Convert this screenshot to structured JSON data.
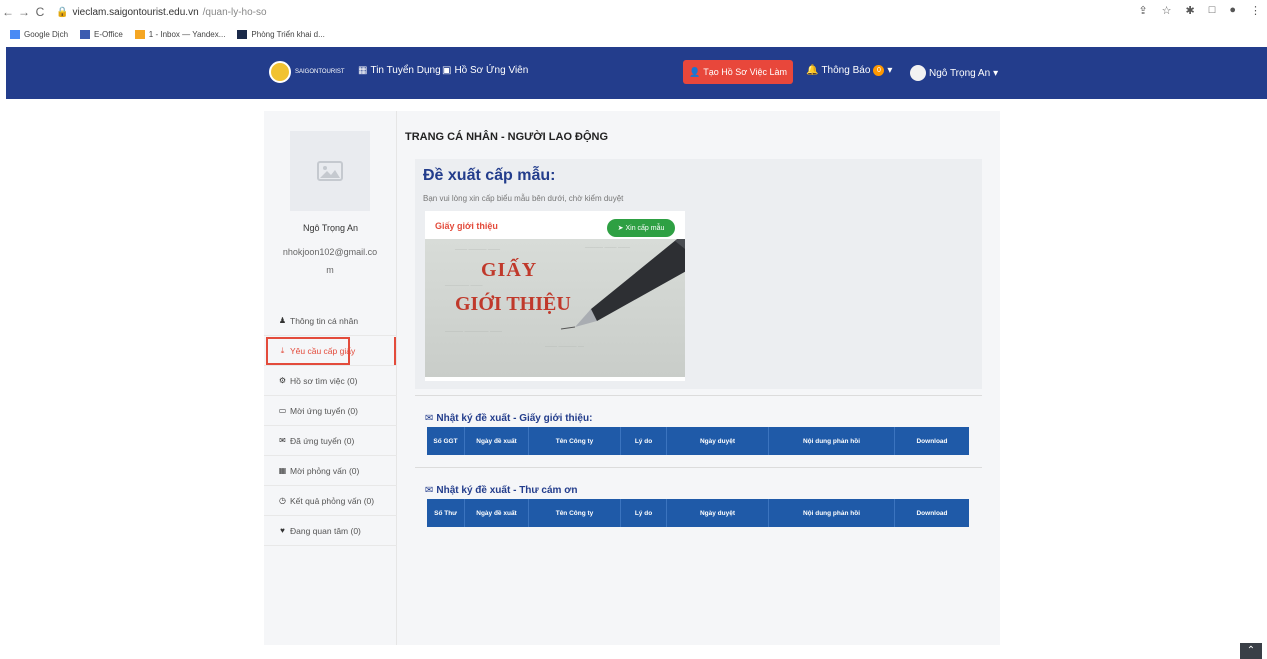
{
  "browser": {
    "url_host": "vieclam.saigontourist.edu.vn",
    "url_path": "/quan-ly-ho-so",
    "bookmarks": [
      "Google Dịch",
      "E-Office",
      "1 - Inbox — Yandex...",
      "Phòng Triển khai d..."
    ]
  },
  "header": {
    "logo_text": "SAIGONTOURIST",
    "nav_jobs": "Tin Tuyển Dụng",
    "nav_candidates": "Hồ Sơ Ứng Viên",
    "create_cv": "Tạo Hồ Sơ Việc Làm",
    "notifications": "Thông Báo",
    "notification_count": "0",
    "user_name": "Ngô Trọng An"
  },
  "sidebar": {
    "name": "Ngô Trọng An",
    "email": "nhokjoon102@gmail.com",
    "items": [
      {
        "label": "Thông tin cá nhân",
        "icon": "user-icon"
      },
      {
        "label": "Yêu cầu cấp giấy",
        "icon": "download-icon"
      },
      {
        "label": "Hồ sơ tìm việc (0)",
        "icon": "gear-icon"
      },
      {
        "label": "Mời ứng tuyển (0)",
        "icon": "card-icon"
      },
      {
        "label": "Đã ứng tuyển (0)",
        "icon": "envelope-icon"
      },
      {
        "label": "Mời phỏng vấn (0)",
        "icon": "grid-icon"
      },
      {
        "label": "Kết quả phỏng vấn (0)",
        "icon": "clock-icon"
      },
      {
        "label": "Đang quan tâm (0)",
        "icon": "heart-icon"
      }
    ]
  },
  "main": {
    "page_title": "TRANG CÁ NHÂN - NGƯỜI LAO ĐỘNG",
    "propose_title": "Đề xuất cấp mẫu:",
    "propose_sub": "Bạn vui lòng xin cấp biểu mẫu bên dưới, chờ kiểm duyệt",
    "doc_title": "Giấy giới thiệu",
    "doc_button": "Xin cấp mẫu",
    "doc_image_line1": "GIẤY",
    "doc_image_line2": "GIỚI THIỆU",
    "log1_title": "Nhật ký đề xuất - Giấy giới thiệu:",
    "log1_headers": [
      "Số GGT",
      "Ngày đề xuất",
      "Tên Công ty",
      "Lý do",
      "Ngày duyệt",
      "Nội dung phản hồi",
      "Download"
    ],
    "log2_title": "Nhật ký đề xuất - Thư cám ơn",
    "log2_headers": [
      "Số Thư",
      "Ngày đề xuất",
      "Tên Công ty",
      "Lý do",
      "Ngày duyệt",
      "Nội dung phản hồi",
      "Download"
    ]
  },
  "colors": {
    "header_bg": "#233d8c",
    "accent_red": "#e34b3b",
    "table_header": "#1f5aa8",
    "button_green": "#2ea043"
  }
}
